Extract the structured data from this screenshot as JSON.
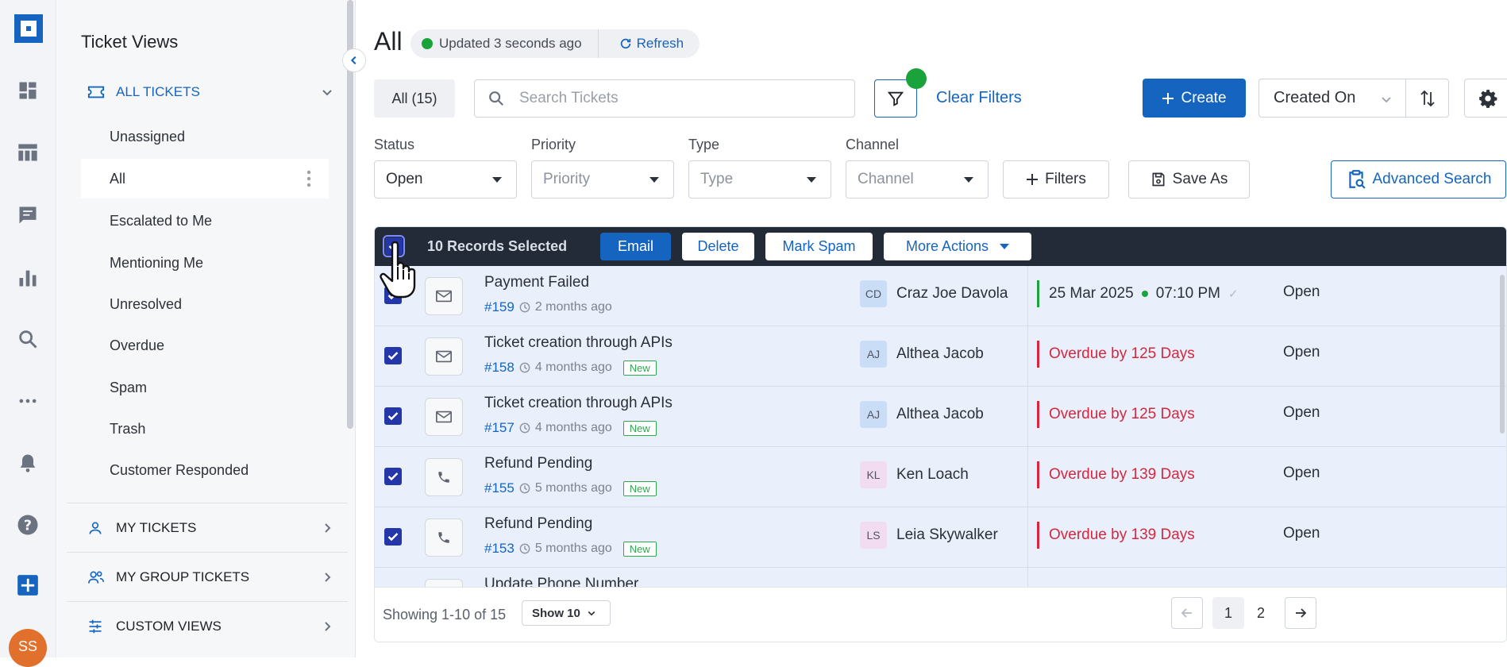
{
  "rail": {
    "icons": [
      "dashboard-icon",
      "table-icon",
      "chat-icon",
      "reports-icon",
      "search-icon",
      "more-icon",
      "bell-icon",
      "help-icon",
      "add-icon"
    ],
    "avatar": "SS",
    "brand_color": "#1565c0"
  },
  "views_panel": {
    "title": "Ticket Views",
    "all_tickets_label": "ALL TICKETS",
    "items": [
      {
        "label": "Unassigned"
      },
      {
        "label": "All",
        "selected": true
      },
      {
        "label": "Escalated to Me"
      },
      {
        "label": "Mentioning Me"
      },
      {
        "label": "Unresolved"
      },
      {
        "label": "Overdue"
      },
      {
        "label": "Spam"
      },
      {
        "label": "Trash"
      },
      {
        "label": "Customer Responded"
      }
    ],
    "sections": [
      {
        "label": "MY TICKETS"
      },
      {
        "label": "MY GROUP TICKETS"
      },
      {
        "label": "CUSTOM VIEWS"
      }
    ]
  },
  "header": {
    "title": "All",
    "updated": "Updated 3 seconds ago",
    "refresh": "Refresh"
  },
  "toolbar": {
    "all_tab": "All (15)",
    "search_placeholder": "Search Tickets",
    "clear_filters": "Clear Filters",
    "create": "Create",
    "sort_by": "Created On"
  },
  "filters": {
    "status": {
      "label": "Status",
      "value": "Open"
    },
    "priority": {
      "label": "Priority",
      "placeholder": "Priority"
    },
    "type": {
      "label": "Type",
      "placeholder": "Type"
    },
    "channel": {
      "label": "Channel",
      "placeholder": "Channel"
    },
    "filters_btn": "Filters",
    "save_as": "Save As",
    "advanced_search": "Advanced Search"
  },
  "bulk_bar": {
    "selected": "10 Records Selected",
    "email": "Email",
    "delete": "Delete",
    "mark_spam": "Mark Spam",
    "more_actions": "More Actions"
  },
  "tickets": [
    {
      "subject": "Payment Failed",
      "id": "#159",
      "age": "2 months ago",
      "new": false,
      "channel_icon": "mail-icon",
      "agent_initials": "CD",
      "agent": "Craz Joe Davola",
      "due_date": "25 Mar 2025",
      "due_time": "07:10 PM",
      "status": "Open"
    },
    {
      "subject": "Ticket creation through APIs",
      "id": "#158",
      "age": "4 months ago",
      "new": true,
      "channel_icon": "mail-icon",
      "agent_initials": "AJ",
      "agent": "Althea Jacob",
      "due": "Overdue by 125 Days",
      "status": "Open"
    },
    {
      "subject": "Ticket creation through APIs",
      "id": "#157",
      "age": "4 months ago",
      "new": true,
      "channel_icon": "mail-icon",
      "agent_initials": "AJ",
      "agent": "Althea Jacob",
      "due": "Overdue by 125 Days",
      "status": "Open"
    },
    {
      "subject": "Refund Pending",
      "id": "#155",
      "age": "5 months ago",
      "new": true,
      "channel_icon": "phone-icon",
      "agent_initials": "KL",
      "agent": "Ken Loach",
      "due": "Overdue by 139 Days",
      "status": "Open"
    },
    {
      "subject": "Refund Pending",
      "id": "#153",
      "age": "5 months ago",
      "new": true,
      "channel_icon": "phone-icon",
      "agent_initials": "LS",
      "agent": "Leia Skywalker",
      "due": "Overdue by 139 Days",
      "status": "Open"
    },
    {
      "subject": "Update Phone Number"
    }
  ],
  "new_badge": "New",
  "footer": {
    "showing": "Showing 1-10 of 15",
    "per_page": "Show 10",
    "pages": [
      "1",
      "2"
    ]
  },
  "colors": {
    "overdue": "#d7263d",
    "ok": "#1aa33a",
    "selected_row": "#eaf0fb",
    "bulk_bar": "#232a38"
  }
}
